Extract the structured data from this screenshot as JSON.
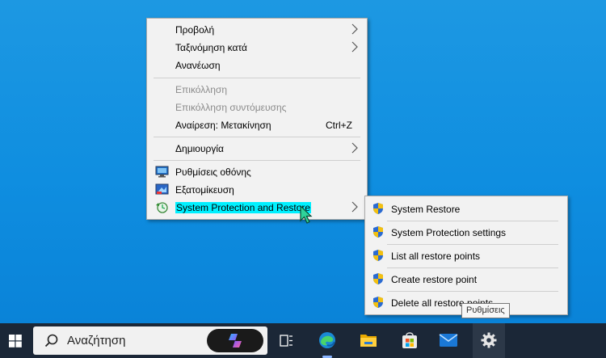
{
  "context_menu": {
    "view": "Προβολή",
    "sort_by": "Ταξινόμηση κατά",
    "refresh": "Ανανέωση",
    "paste": "Επικόλληση",
    "paste_shortcut": "Επικόλληση συντόμευσης",
    "undo_move": "Αναίρεση: Μετακίνηση",
    "undo_shortcut": "Ctrl+Z",
    "new": "Δημιουργία",
    "display_settings": "Ρυθμίσεις οθόνης",
    "personalize": "Εξατομίκευση",
    "system_protection": "System Protection and Restore"
  },
  "submenu": {
    "items": [
      "System Restore",
      "System Protection settings",
      "List all restore points",
      "Create restore point",
      "Delete all restore points"
    ]
  },
  "tooltip": "Ρυθμίσεις",
  "taskbar": {
    "search_placeholder": "Αναζήτηση"
  },
  "icons": {
    "start": "windows-logo-icon",
    "search": "search-icon",
    "copilot": "copilot-icon",
    "task_view": "task-view-icon",
    "edge": "edge-icon",
    "explorer": "file-explorer-icon",
    "store": "store-icon",
    "mail": "mail-icon",
    "settings": "settings-gear-icon",
    "shield": "uac-shield-icon"
  },
  "colors": {
    "desktop": "#0f8ee0",
    "taskbar": "#1b2737",
    "highlight": "#00f0ff"
  }
}
